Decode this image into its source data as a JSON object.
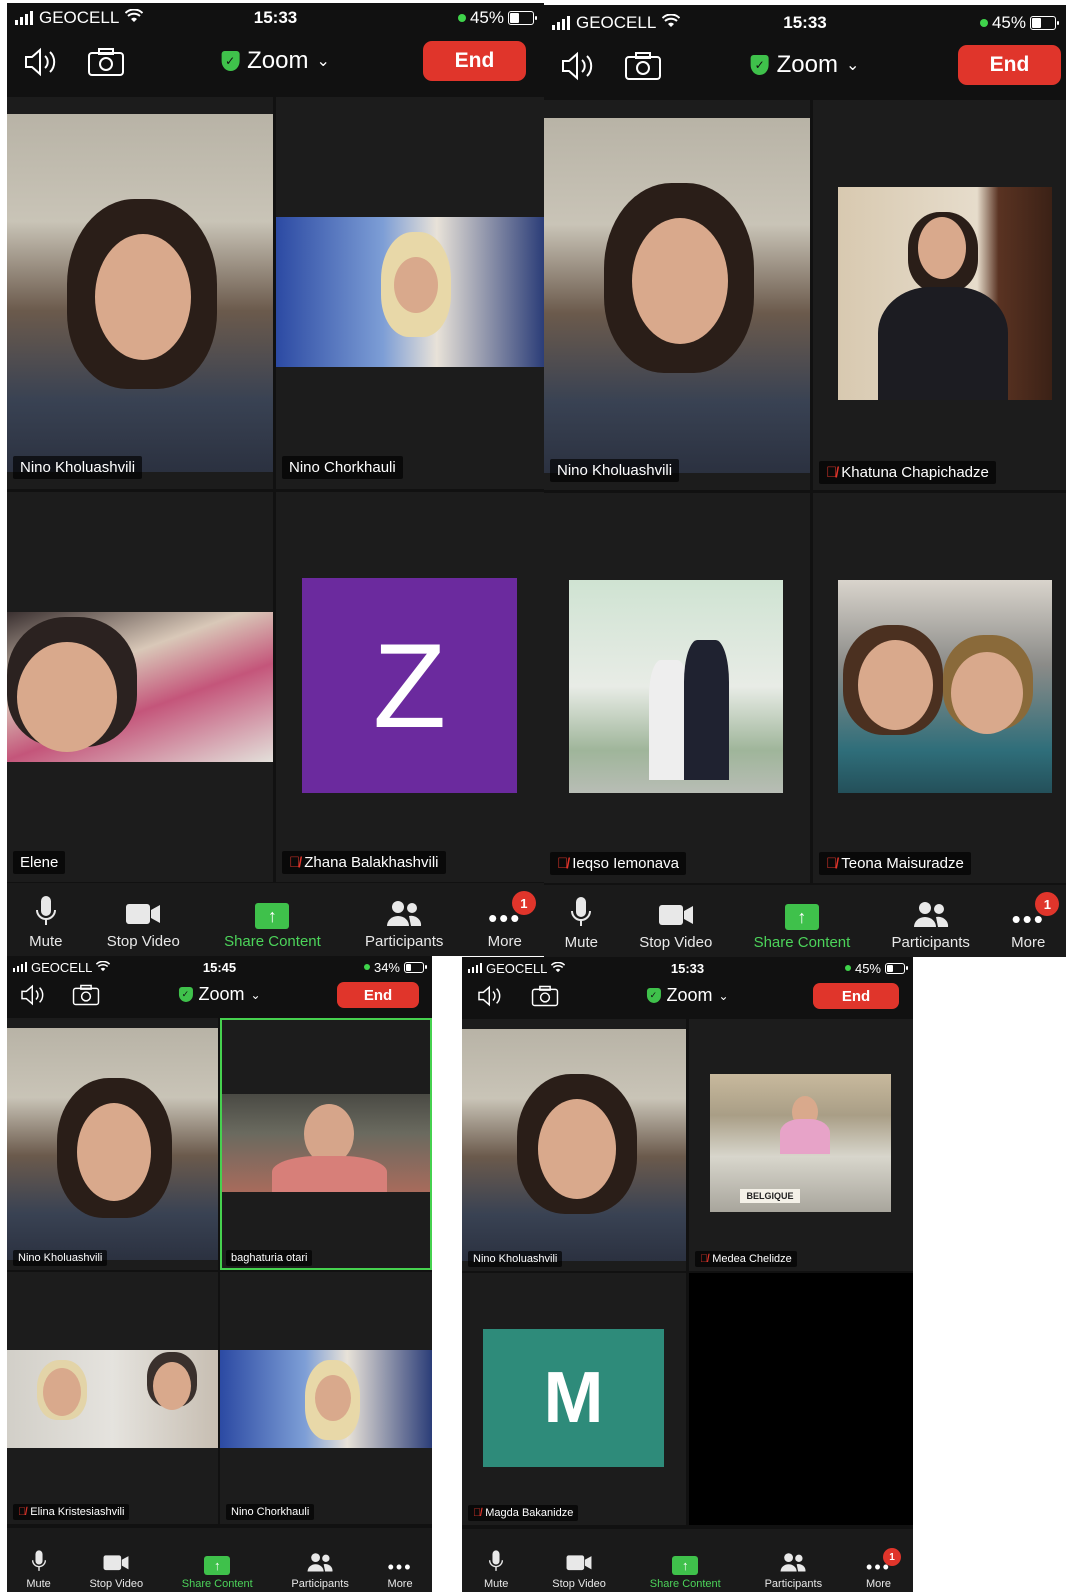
{
  "screens": [
    {
      "status": {
        "carrier": "GEOCELL",
        "time": "15:33",
        "battery": "45%",
        "battery_level": 0.45
      },
      "title": "Zoom",
      "end_label": "End",
      "tiles": [
        {
          "name": "Nino Kholuashvili",
          "muted": false
        },
        {
          "name": "Nino Chorkhauli",
          "muted": false
        },
        {
          "name": "Elene",
          "muted": false
        },
        {
          "name": "Zhana Balakhashvili",
          "muted": true,
          "avatar_letter": "Z",
          "avatar_color": "#6b2a9e"
        }
      ],
      "toolbar": [
        {
          "label": "Mute",
          "icon": "microphone-icon"
        },
        {
          "label": "Stop Video",
          "icon": "video-camera-icon"
        },
        {
          "label": "Share Content",
          "icon": "share-arrow-icon"
        },
        {
          "label": "Participants",
          "icon": "participants-icon"
        },
        {
          "label": "More",
          "icon": "more-dots-icon",
          "badge": "1"
        }
      ]
    },
    {
      "status": {
        "carrier": "GEOCELL",
        "time": "15:33",
        "battery": "45%",
        "battery_level": 0.45
      },
      "title": "Zoom",
      "end_label": "End",
      "tiles": [
        {
          "name": "Nino Kholuashvili",
          "muted": false
        },
        {
          "name": "Khatuna Chapichadze",
          "muted": true
        },
        {
          "name": "Ieqso Iemonava",
          "muted": true
        },
        {
          "name": "Teona Maisuradze",
          "muted": true
        }
      ],
      "toolbar": [
        {
          "label": "Mute",
          "icon": "microphone-icon"
        },
        {
          "label": "Stop Video",
          "icon": "video-camera-icon"
        },
        {
          "label": "Share Content",
          "icon": "share-arrow-icon"
        },
        {
          "label": "Participants",
          "icon": "participants-icon"
        },
        {
          "label": "More",
          "icon": "more-dots-icon",
          "badge": "1"
        }
      ]
    },
    {
      "status": {
        "carrier": "GEOCELL",
        "time": "15:45",
        "battery": "34%",
        "battery_level": 0.34
      },
      "title": "Zoom",
      "end_label": "End",
      "tiles": [
        {
          "name": "Nino Kholuashvili",
          "muted": false
        },
        {
          "name": "baghaturia otari",
          "muted": false
        },
        {
          "name": "Elina Kristesiashvili",
          "muted": true
        },
        {
          "name": "Nino Chorkhauli",
          "muted": false
        }
      ],
      "toolbar": [
        {
          "label": "Mute",
          "icon": "microphone-icon"
        },
        {
          "label": "Stop Video",
          "icon": "video-camera-icon"
        },
        {
          "label": "Share Content",
          "icon": "share-arrow-icon"
        },
        {
          "label": "Participants",
          "icon": "participants-icon"
        },
        {
          "label": "More",
          "icon": "more-dots-icon"
        }
      ]
    },
    {
      "status": {
        "carrier": "GEOCELL",
        "time": "15:33",
        "battery": "45%",
        "battery_level": 0.45
      },
      "title": "Zoom",
      "end_label": "End",
      "tiles": [
        {
          "name": "Nino Kholuashvili",
          "muted": false
        },
        {
          "name": "Medea Chelidze",
          "muted": true
        },
        {
          "name": "Magda Bakanidze",
          "muted": true,
          "avatar_letter": "M",
          "avatar_color": "#2e8b7a"
        }
      ],
      "toolbar": [
        {
          "label": "Mute",
          "icon": "microphone-icon"
        },
        {
          "label": "Stop Video",
          "icon": "video-camera-icon"
        },
        {
          "label": "Share Content",
          "icon": "share-arrow-icon"
        },
        {
          "label": "Participants",
          "icon": "participants-icon"
        },
        {
          "label": "More",
          "icon": "more-dots-icon",
          "badge": "1"
        }
      ]
    }
  ],
  "colors": {
    "end_red": "#e0352b",
    "zoom_green": "#3fc14b",
    "active_border": "#46d14f"
  }
}
